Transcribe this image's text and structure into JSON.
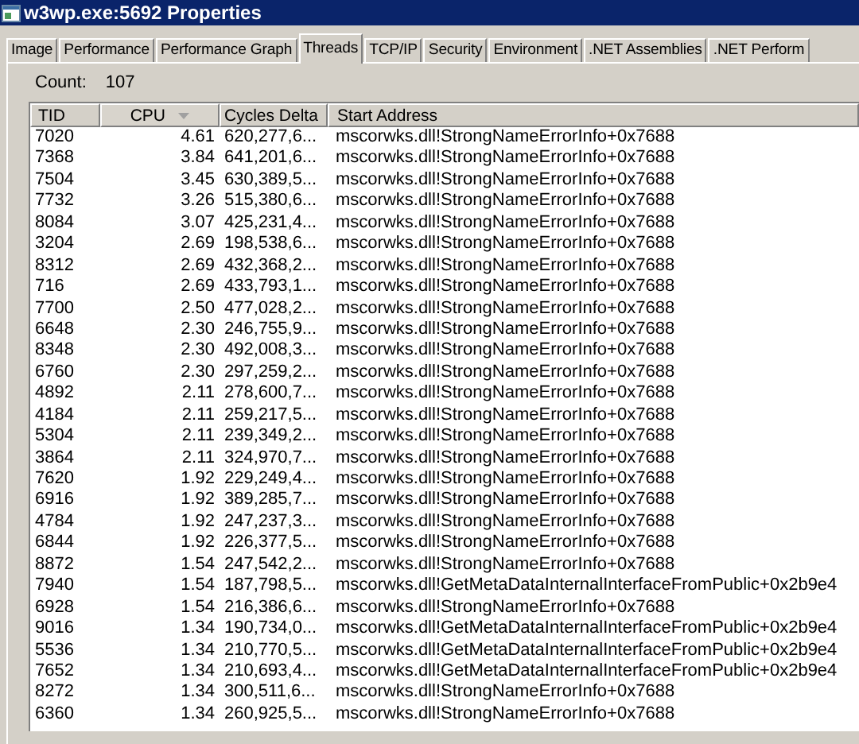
{
  "window": {
    "title": "w3wp.exe:5692 Properties"
  },
  "tabs": [
    {
      "label": "Image",
      "selected": false
    },
    {
      "label": "Performance",
      "selected": false
    },
    {
      "label": "Performance Graph",
      "selected": false
    },
    {
      "label": "Threads",
      "selected": true
    },
    {
      "label": "TCP/IP",
      "selected": false
    },
    {
      "label": "Security",
      "selected": false
    },
    {
      "label": "Environment",
      "selected": false
    },
    {
      "label": ".NET Assemblies",
      "selected": false
    },
    {
      "label": ".NET Perform",
      "selected": false
    }
  ],
  "count": {
    "label": "Count:",
    "value": "107"
  },
  "table": {
    "columns": [
      {
        "label": "TID",
        "sorted": false
      },
      {
        "label": "CPU",
        "sorted": true
      },
      {
        "label": "Cycles Delta",
        "sorted": false
      },
      {
        "label": "Start Address",
        "sorted": false
      }
    ],
    "rows": [
      [
        "7020",
        "4.61",
        "620,277,6...",
        "mscorwks.dll!StrongNameErrorInfo+0x7688"
      ],
      [
        "7368",
        "3.84",
        "641,201,6...",
        "mscorwks.dll!StrongNameErrorInfo+0x7688"
      ],
      [
        "7504",
        "3.45",
        "630,389,5...",
        "mscorwks.dll!StrongNameErrorInfo+0x7688"
      ],
      [
        "7732",
        "3.26",
        "515,380,6...",
        "mscorwks.dll!StrongNameErrorInfo+0x7688"
      ],
      [
        "8084",
        "3.07",
        "425,231,4...",
        "mscorwks.dll!StrongNameErrorInfo+0x7688"
      ],
      [
        "3204",
        "2.69",
        "198,538,6...",
        "mscorwks.dll!StrongNameErrorInfo+0x7688"
      ],
      [
        "8312",
        "2.69",
        "432,368,2...",
        "mscorwks.dll!StrongNameErrorInfo+0x7688"
      ],
      [
        "716",
        "2.69",
        "433,793,1...",
        "mscorwks.dll!StrongNameErrorInfo+0x7688"
      ],
      [
        "7700",
        "2.50",
        "477,028,2...",
        "mscorwks.dll!StrongNameErrorInfo+0x7688"
      ],
      [
        "6648",
        "2.30",
        "246,755,9...",
        "mscorwks.dll!StrongNameErrorInfo+0x7688"
      ],
      [
        "8348",
        "2.30",
        "492,008,3...",
        "mscorwks.dll!StrongNameErrorInfo+0x7688"
      ],
      [
        "6760",
        "2.30",
        "297,259,2...",
        "mscorwks.dll!StrongNameErrorInfo+0x7688"
      ],
      [
        "4892",
        "2.11",
        "278,600,7...",
        "mscorwks.dll!StrongNameErrorInfo+0x7688"
      ],
      [
        "4184",
        "2.11",
        "259,217,5...",
        "mscorwks.dll!StrongNameErrorInfo+0x7688"
      ],
      [
        "5304",
        "2.11",
        "239,349,2...",
        "mscorwks.dll!StrongNameErrorInfo+0x7688"
      ],
      [
        "3864",
        "2.11",
        "324,970,7...",
        "mscorwks.dll!StrongNameErrorInfo+0x7688"
      ],
      [
        "7620",
        "1.92",
        "229,249,4...",
        "mscorwks.dll!StrongNameErrorInfo+0x7688"
      ],
      [
        "6916",
        "1.92",
        "389,285,7...",
        "mscorwks.dll!StrongNameErrorInfo+0x7688"
      ],
      [
        "4784",
        "1.92",
        "247,237,3...",
        "mscorwks.dll!StrongNameErrorInfo+0x7688"
      ],
      [
        "6844",
        "1.92",
        "226,377,5...",
        "mscorwks.dll!StrongNameErrorInfo+0x7688"
      ],
      [
        "8872",
        "1.54",
        "247,542,2...",
        "mscorwks.dll!StrongNameErrorInfo+0x7688"
      ],
      [
        "7940",
        "1.54",
        "187,798,5...",
        "mscorwks.dll!GetMetaDataInternalInterfaceFromPublic+0x2b9e4"
      ],
      [
        "6928",
        "1.54",
        "216,386,6...",
        "mscorwks.dll!StrongNameErrorInfo+0x7688"
      ],
      [
        "9016",
        "1.34",
        "190,734,0...",
        "mscorwks.dll!GetMetaDataInternalInterfaceFromPublic+0x2b9e4"
      ],
      [
        "5536",
        "1.34",
        "210,770,5...",
        "mscorwks.dll!GetMetaDataInternalInterfaceFromPublic+0x2b9e4"
      ],
      [
        "7652",
        "1.34",
        "210,693,4...",
        "mscorwks.dll!GetMetaDataInternalInterfaceFromPublic+0x2b9e4"
      ],
      [
        "8272",
        "1.34",
        "300,511,6...",
        "mscorwks.dll!StrongNameErrorInfo+0x7688"
      ],
      [
        "6360",
        "1.34",
        "260,925,5...",
        "mscorwks.dll!StrongNameErrorInfo+0x7688"
      ]
    ]
  }
}
